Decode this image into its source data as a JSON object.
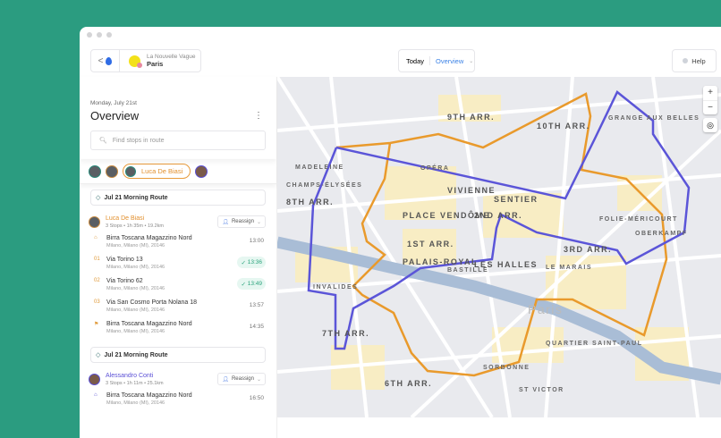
{
  "header": {
    "back": "<",
    "company": "La Nouvelle Vague",
    "city": "Paris",
    "today": "Today",
    "view": "Overview",
    "help": "Help"
  },
  "sidebar": {
    "date": "Monday, July 21st",
    "title": "Overview",
    "search_placeholder": "Find stops in route",
    "selected_driver": "Luca De Biasi",
    "routes": [
      {
        "name": "Jul 21 Morning Route",
        "driver": "Luca De Biasi",
        "driver_color": "#e2902e",
        "meta": "3 Stops • 1h 35m • 19.2km",
        "reassign": "Reassign",
        "stops": [
          {
            "idx": "⌂",
            "name": "Birra Toscana Magazzino Nord",
            "addr": "Milano, Milano (MI), 20146",
            "time": "13:00",
            "done": false
          },
          {
            "idx": "01",
            "name": "Via Torino 13",
            "addr": "Milano, Milano (MI), 20146",
            "time": "13:36",
            "done": true
          },
          {
            "idx": "02",
            "name": "Via Torino 62",
            "addr": "Milano, Milano (MI), 20146",
            "time": "13:49",
            "done": true
          },
          {
            "idx": "03",
            "name": "Via San Cosmo Porta Nolana 18",
            "addr": "Milano, Milano (MI), 20146",
            "time": "13:57",
            "done": false
          },
          {
            "idx": "⚑",
            "name": "Birra Toscana Magazzino Nord",
            "addr": "Milano, Milano (MI), 20146",
            "time": "14:35",
            "done": false
          }
        ]
      },
      {
        "name": "Jul 21 Morning Route",
        "driver": "Alessandro Conti",
        "driver_color": "#5b50d6",
        "meta": "3 Stops • 1h 11m • 25.1km",
        "reassign": "Reassign",
        "stops": [
          {
            "idx": "⌂",
            "name": "Birra Toscana Magazzino Nord",
            "addr": "Milano, Milano (MI), 20146",
            "time": "16:50",
            "done": false
          }
        ]
      }
    ]
  },
  "map": {
    "labels": [
      "9TH ARR.",
      "10TH ARR.",
      "8TH ARR.",
      "VIVIENNE",
      "SENTIER",
      "2ND ARR.",
      "PLACE VENDÔME",
      "1ST ARR.",
      "PALAIS-ROYAL",
      "LES HALLES",
      "3RD ARR.",
      "7TH ARR.",
      "6TH ARR.",
      "MADELEINE",
      "CHAMPS-ÉLYSÉES",
      "GRANGE AUX BELLES",
      "OPÉRA",
      "BASTILLE",
      "LE MARAIS",
      "INVALIDES",
      "SORBONNE",
      "ST VICTOR",
      "QUARTIER SAINT-PAUL",
      "FOLIE-MÉRICOURT",
      "OBERKAMPF",
      "Paris"
    ],
    "zoom_in": "+",
    "zoom_out": "−",
    "colors": {
      "route_orange": "#e99a2c",
      "route_blue": "#5b55d8"
    }
  }
}
